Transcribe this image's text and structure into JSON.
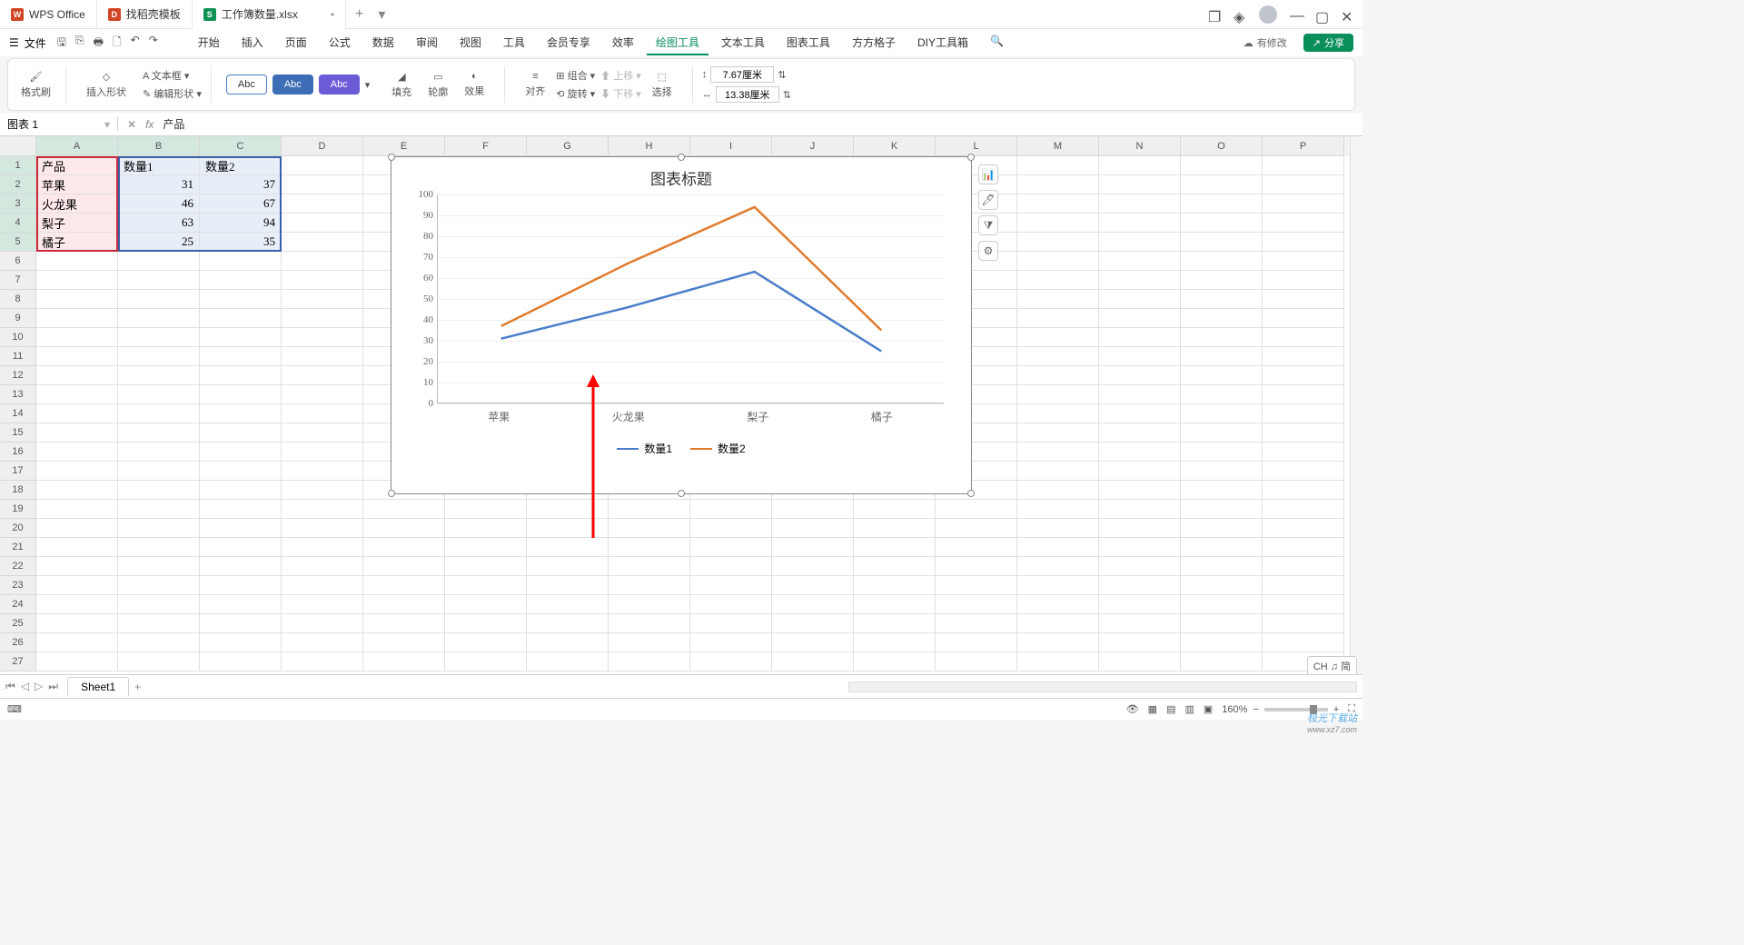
{
  "titlebar": {
    "tabs": [
      {
        "label": "WPS Office",
        "logo": "W",
        "color": "red"
      },
      {
        "label": "找稻壳模板",
        "logo": "D",
        "color": "red"
      },
      {
        "label": "工作簿数量.xlsx",
        "logo": "S",
        "color": "green"
      }
    ],
    "add": "+"
  },
  "menu": {
    "file": "文件",
    "tabs": [
      "开始",
      "插入",
      "页面",
      "公式",
      "数据",
      "审阅",
      "视图",
      "工具",
      "会员专享",
      "效率",
      "绘图工具",
      "文本工具",
      "图表工具",
      "方方格子",
      "DIY工具箱"
    ],
    "active": "绘图工具",
    "has_changes": "有修改",
    "share": "分享"
  },
  "ribbon": {
    "format_painter": "格式刷",
    "insert_shape": "插入形状",
    "text_box": "文本框",
    "edit_shape": "编辑形状",
    "abc": "Abc",
    "fill": "填充",
    "outline": "轮廓",
    "effects": "效果",
    "align": "对齐",
    "group": "组合",
    "rotate": "旋转",
    "up": "上移",
    "down": "下移",
    "select": "选择",
    "width_val": "7.67厘米",
    "height_val": "13.38厘米"
  },
  "fx": {
    "name": "图表 1",
    "formula": "产品"
  },
  "columns": [
    "A",
    "B",
    "C",
    "D",
    "E",
    "F",
    "G",
    "H",
    "I",
    "J",
    "K",
    "L",
    "M",
    "N",
    "O",
    "P"
  ],
  "rows": 27,
  "table": {
    "headers": [
      "产品",
      "数量1",
      "数量2"
    ],
    "data": [
      [
        "苹果",
        31,
        37
      ],
      [
        "火龙果",
        46,
        67
      ],
      [
        "梨子",
        63,
        94
      ],
      [
        "橘子",
        25,
        35
      ]
    ]
  },
  "chart_data": {
    "type": "line",
    "title": "图表标题",
    "categories": [
      "苹果",
      "火龙果",
      "梨子",
      "橘子"
    ],
    "series": [
      {
        "name": "数量1",
        "values": [
          31,
          46,
          63,
          25
        ],
        "color": "#4a7dc9"
      },
      {
        "name": "数量2",
        "values": [
          37,
          67,
          94,
          35
        ],
        "color": "#e07b2e"
      }
    ],
    "ylim": [
      0,
      100
    ],
    "yticks": [
      0,
      10,
      20,
      30,
      40,
      50,
      60,
      70,
      80,
      90,
      100
    ]
  },
  "sheet": {
    "name": "Sheet1"
  },
  "status": {
    "zoom_label": "160%"
  },
  "badge": "CH ♫ 简",
  "watermark": {
    "name": "极光下载站",
    "url": "www.xz7.com"
  }
}
